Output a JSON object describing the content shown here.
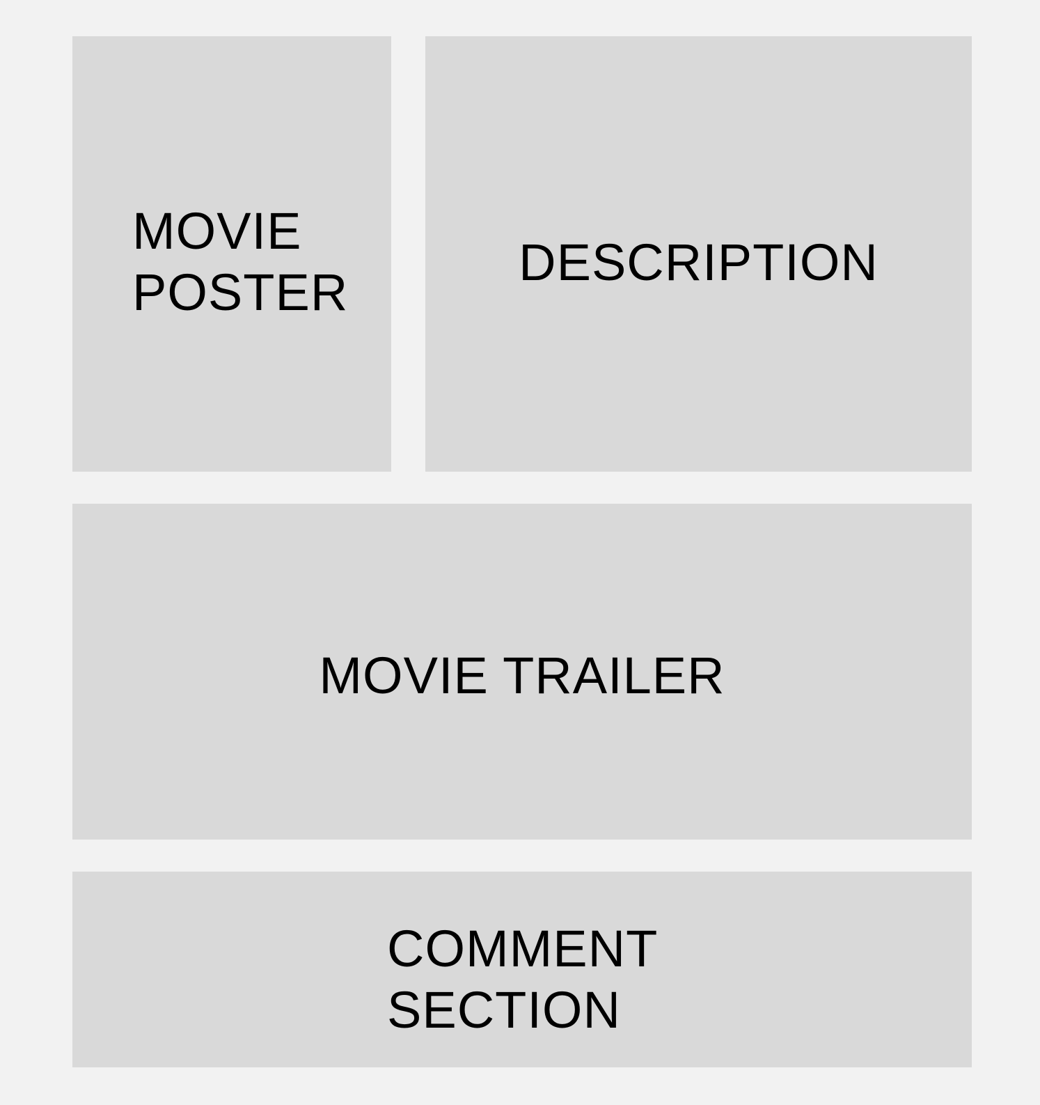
{
  "layout": {
    "poster": {
      "line1": "MOVIE",
      "line2": "POSTER"
    },
    "description": {
      "label": "DESCRIPTION"
    },
    "trailer": {
      "label": "MOVIE TRAILER"
    },
    "comments": {
      "line1": "COMMENT",
      "line2": "SECTION"
    }
  },
  "colors": {
    "page_background": "#f2f2f2",
    "panel_background": "#d9d9d9",
    "text": "#000000"
  }
}
